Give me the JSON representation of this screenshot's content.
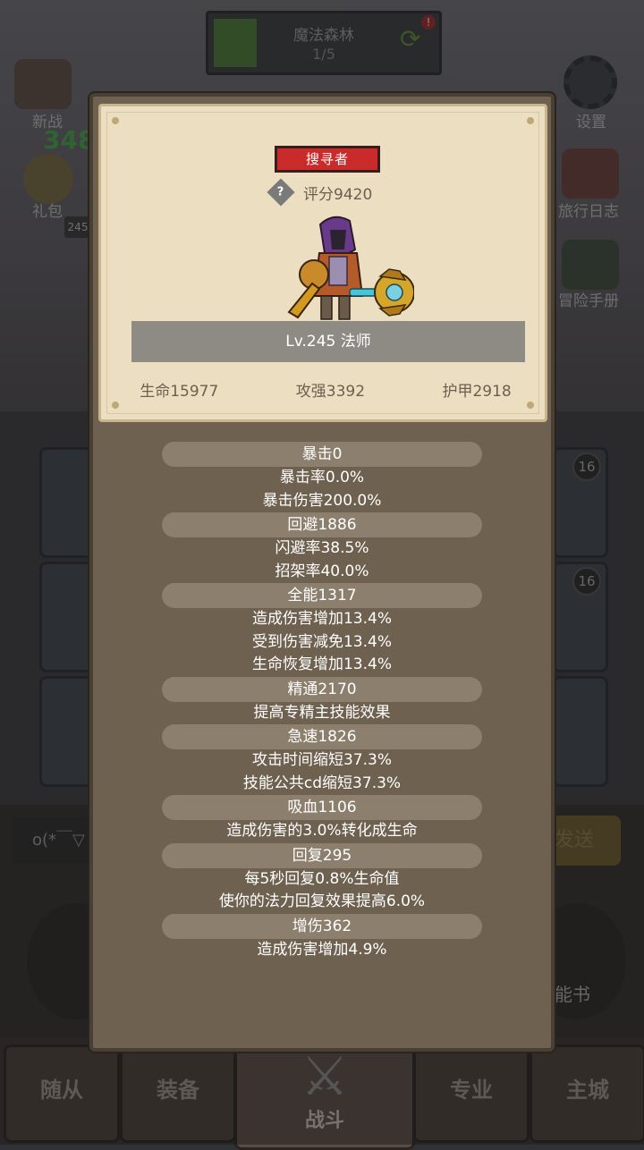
{
  "background": {
    "stage_title": "魔法森林",
    "stage_progress": "1/5",
    "left_icons": [
      "新战",
      "礼包"
    ],
    "left_number": "348",
    "left_badge": "245",
    "right_icons": [
      "设置",
      "旅行日志",
      "冒险手册"
    ],
    "card_counts": [
      "16",
      "16"
    ],
    "chat_placeholder": "o(*￣▽",
    "send_label": "发送",
    "skillbook_label": "能书",
    "nav": {
      "followers": "随从",
      "equipment": "装备",
      "battle": "战斗",
      "profession": "专业",
      "main_city": "主城"
    }
  },
  "hero_card": {
    "class_tag": "搜寻者",
    "score": "评分9420",
    "level": "Lv.245 法师",
    "stats": {
      "hp": "生命15977",
      "attack": "攻强3392",
      "armor": "护甲2918"
    }
  },
  "attributes": [
    {
      "head": "暴击0",
      "lines": [
        "暴击率0.0%",
        "暴击伤害200.0%"
      ]
    },
    {
      "head": "回避1886",
      "lines": [
        "闪避率38.5%",
        "招架率40.0%"
      ]
    },
    {
      "head": "全能1317",
      "lines": [
        "造成伤害增加13.4%",
        "受到伤害减免13.4%",
        "生命恢复增加13.4%"
      ]
    },
    {
      "head": "精通2170",
      "lines": [
        "提高专精主技能效果"
      ]
    },
    {
      "head": "急速1826",
      "lines": [
        "攻击时间缩短37.3%",
        "技能公共cd缩短37.3%"
      ]
    },
    {
      "head": "吸血1106",
      "lines": [
        "造成伤害的3.0%转化成生命"
      ]
    },
    {
      "head": "回复295",
      "lines": [
        "每5秒回复0.8%生命值",
        "使你的法力回复效果提高6.0%"
      ]
    },
    {
      "head": "增伤362",
      "lines": [
        "造成伤害增加4.9%"
      ]
    }
  ]
}
